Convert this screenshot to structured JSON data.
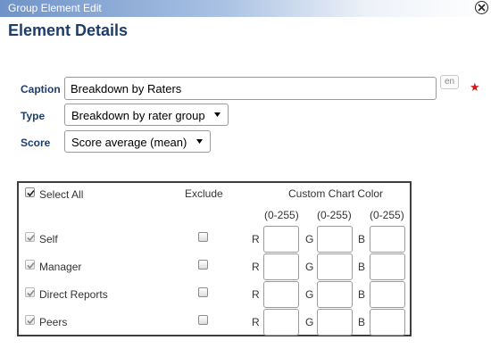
{
  "window": {
    "title": "Group Element Edit"
  },
  "page_title": "Element Details",
  "caption": {
    "label": "Caption",
    "value": "Breakdown by Raters",
    "lang": "en",
    "required_marker": "★"
  },
  "type": {
    "label": "Type",
    "selected": "Breakdown by rater group"
  },
  "score": {
    "label": "Score",
    "selected": "Score average (mean)"
  },
  "table": {
    "select_all_label": "Select All",
    "exclude_header": "Exclude",
    "color_header": "Custom Chart Color",
    "ranges": [
      "(0-255)",
      "(0-255)",
      "(0-255)"
    ],
    "channels": [
      "R",
      "G",
      "B"
    ],
    "rows": [
      {
        "label": "Self",
        "checked": true,
        "exclude": false
      },
      {
        "label": "Manager",
        "checked": true,
        "exclude": false
      },
      {
        "label": "Direct Reports",
        "checked": true,
        "exclude": false
      },
      {
        "label": "Peers",
        "checked": true,
        "exclude": false
      }
    ]
  },
  "colors": {
    "title_text": "#ffffff",
    "heading": "#1f3d6b",
    "required": "#d21414"
  }
}
